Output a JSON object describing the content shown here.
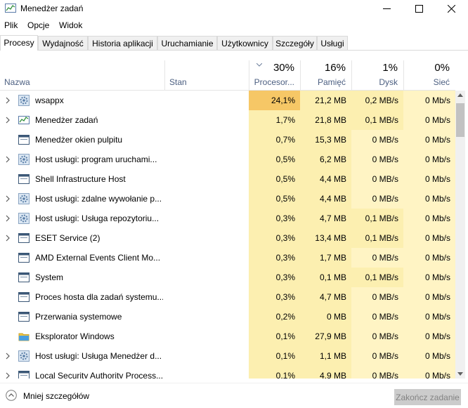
{
  "window": {
    "title": "Menedżer zadań",
    "icon": "task-manager-icon"
  },
  "menu": [
    "Plik",
    "Opcje",
    "Widok"
  ],
  "tabs": [
    {
      "label": "Procesy",
      "active": true
    },
    {
      "label": "Wydajność",
      "active": false
    },
    {
      "label": "Historia aplikacji",
      "active": false
    },
    {
      "label": "Uruchamianie",
      "active": false
    },
    {
      "label": "Użytkownicy",
      "active": false
    },
    {
      "label": "Szczegóły",
      "active": false
    },
    {
      "label": "Usługi",
      "active": false
    }
  ],
  "columns": {
    "name": "Nazwa",
    "status": "Stan",
    "cpu": {
      "pct": "30%",
      "label": "Procesor..."
    },
    "memory": {
      "pct": "16%",
      "label": "Pamięć"
    },
    "disk": {
      "pct": "1%",
      "label": "Dysk"
    },
    "network": {
      "pct": "0%",
      "label": "Sieć"
    }
  },
  "processes": [
    {
      "name": "wsappx",
      "icon": "gear-icon",
      "expandable": true,
      "cpu": "24,1%",
      "memory": "21,2 MB",
      "disk": "0,2 MB/s",
      "network": "0 Mb/s"
    },
    {
      "name": "Menedżer zadań",
      "icon": "task-manager-icon",
      "expandable": true,
      "cpu": "1,7%",
      "memory": "21,8 MB",
      "disk": "0,1 MB/s",
      "network": "0 Mb/s"
    },
    {
      "name": "Menedżer okien pulpitu",
      "icon": "window-icon",
      "expandable": false,
      "cpu": "0,7%",
      "memory": "15,3 MB",
      "disk": "0 MB/s",
      "network": "0 Mb/s"
    },
    {
      "name": "Host usługi: program uruchami...",
      "icon": "gear-icon",
      "expandable": true,
      "cpu": "0,5%",
      "memory": "6,2 MB",
      "disk": "0 MB/s",
      "network": "0 Mb/s"
    },
    {
      "name": "Shell Infrastructure Host",
      "icon": "window-icon",
      "expandable": false,
      "cpu": "0,5%",
      "memory": "4,4 MB",
      "disk": "0 MB/s",
      "network": "0 Mb/s"
    },
    {
      "name": "Host usługi: zdalne wywołanie p...",
      "icon": "gear-icon",
      "expandable": true,
      "cpu": "0,5%",
      "memory": "4,4 MB",
      "disk": "0 MB/s",
      "network": "0 Mb/s"
    },
    {
      "name": "Host usługi: Usługa repozytoriu...",
      "icon": "gear-icon",
      "expandable": true,
      "cpu": "0,3%",
      "memory": "4,7 MB",
      "disk": "0,1 MB/s",
      "network": "0 Mb/s"
    },
    {
      "name": "ESET Service (2)",
      "icon": "window-icon",
      "expandable": true,
      "cpu": "0,3%",
      "memory": "13,4 MB",
      "disk": "0,1 MB/s",
      "network": "0 Mb/s"
    },
    {
      "name": "AMD External Events Client Mo...",
      "icon": "window-icon",
      "expandable": false,
      "cpu": "0,3%",
      "memory": "1,7 MB",
      "disk": "0 MB/s",
      "network": "0 Mb/s"
    },
    {
      "name": "System",
      "icon": "window-icon",
      "expandable": false,
      "cpu": "0,3%",
      "memory": "0,1 MB",
      "disk": "0,1 MB/s",
      "network": "0 Mb/s"
    },
    {
      "name": "Proces hosta dla zadań systemu...",
      "icon": "window-icon",
      "expandable": false,
      "cpu": "0,3%",
      "memory": "4,7 MB",
      "disk": "0 MB/s",
      "network": "0 Mb/s"
    },
    {
      "name": "Przerwania systemowe",
      "icon": "window-icon",
      "expandable": false,
      "cpu": "0,2%",
      "memory": "0 MB",
      "disk": "0 MB/s",
      "network": "0 Mb/s"
    },
    {
      "name": "Eksplorator Windows",
      "icon": "folder-icon",
      "expandable": false,
      "cpu": "0,1%",
      "memory": "27,9 MB",
      "disk": "0 MB/s",
      "network": "0 Mb/s"
    },
    {
      "name": "Host usługi: Usługa Menedżer d...",
      "icon": "gear-icon",
      "expandable": true,
      "cpu": "0,1%",
      "memory": "1,1 MB",
      "disk": "0 MB/s",
      "network": "0 Mb/s"
    },
    {
      "name": "Local Security Authority Process...",
      "icon": "window-icon",
      "expandable": true,
      "cpu": "0,1%",
      "memory": "4,9 MB",
      "disk": "0 MB/s",
      "network": "0 Mb/s"
    }
  ],
  "footer": {
    "fewer_details": "Mniej szczegółów",
    "end_task": "Zakończ zadanie"
  },
  "colors": {
    "cpu_high": "#f6c766",
    "heat_light": "#fff4c4",
    "heat_mid": "#fcefb0",
    "tab_border": "#d9d9d9",
    "header_text": "#4d6082"
  }
}
